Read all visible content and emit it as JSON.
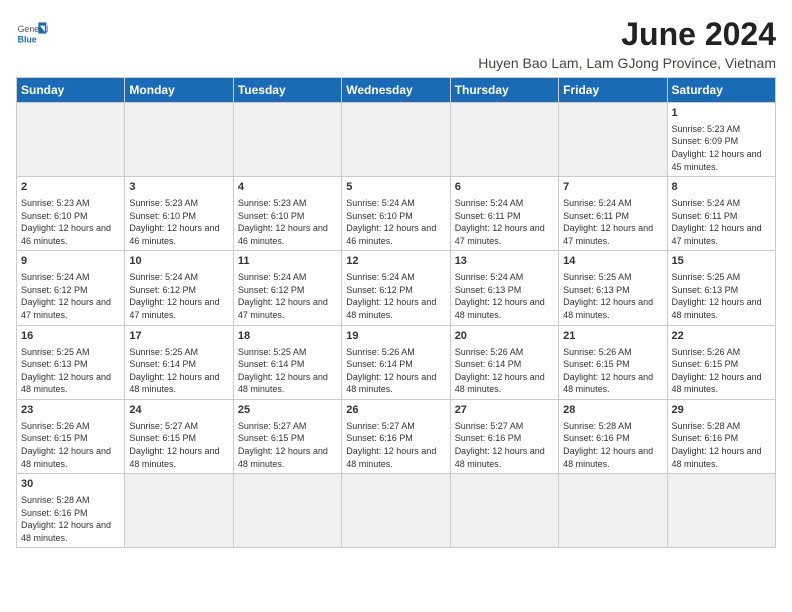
{
  "header": {
    "logo_general": "General",
    "logo_blue": "Blue",
    "month_title": "June 2024",
    "subtitle": "Huyen Bao Lam, Lam GJong Province, Vietnam"
  },
  "days_of_week": [
    "Sunday",
    "Monday",
    "Tuesday",
    "Wednesday",
    "Thursday",
    "Friday",
    "Saturday"
  ],
  "weeks": [
    [
      {
        "day": "",
        "info": "",
        "empty": true
      },
      {
        "day": "",
        "info": "",
        "empty": true
      },
      {
        "day": "",
        "info": "",
        "empty": true
      },
      {
        "day": "",
        "info": "",
        "empty": true
      },
      {
        "day": "",
        "info": "",
        "empty": true
      },
      {
        "day": "",
        "info": "",
        "empty": true
      },
      {
        "day": "1",
        "info": "Sunrise: 5:23 AM\nSunset: 6:09 PM\nDaylight: 12 hours and 45 minutes."
      }
    ],
    [
      {
        "day": "2",
        "info": "Sunrise: 5:23 AM\nSunset: 6:10 PM\nDaylight: 12 hours and 46 minutes."
      },
      {
        "day": "3",
        "info": "Sunrise: 5:23 AM\nSunset: 6:10 PM\nDaylight: 12 hours and 46 minutes."
      },
      {
        "day": "4",
        "info": "Sunrise: 5:23 AM\nSunset: 6:10 PM\nDaylight: 12 hours and 46 minutes."
      },
      {
        "day": "5",
        "info": "Sunrise: 5:24 AM\nSunset: 6:10 PM\nDaylight: 12 hours and 46 minutes."
      },
      {
        "day": "6",
        "info": "Sunrise: 5:24 AM\nSunset: 6:11 PM\nDaylight: 12 hours and 47 minutes."
      },
      {
        "day": "7",
        "info": "Sunrise: 5:24 AM\nSunset: 6:11 PM\nDaylight: 12 hours and 47 minutes."
      },
      {
        "day": "8",
        "info": "Sunrise: 5:24 AM\nSunset: 6:11 PM\nDaylight: 12 hours and 47 minutes."
      }
    ],
    [
      {
        "day": "9",
        "info": "Sunrise: 5:24 AM\nSunset: 6:12 PM\nDaylight: 12 hours and 47 minutes."
      },
      {
        "day": "10",
        "info": "Sunrise: 5:24 AM\nSunset: 6:12 PM\nDaylight: 12 hours and 47 minutes."
      },
      {
        "day": "11",
        "info": "Sunrise: 5:24 AM\nSunset: 6:12 PM\nDaylight: 12 hours and 47 minutes."
      },
      {
        "day": "12",
        "info": "Sunrise: 5:24 AM\nSunset: 6:12 PM\nDaylight: 12 hours and 48 minutes."
      },
      {
        "day": "13",
        "info": "Sunrise: 5:24 AM\nSunset: 6:13 PM\nDaylight: 12 hours and 48 minutes."
      },
      {
        "day": "14",
        "info": "Sunrise: 5:25 AM\nSunset: 6:13 PM\nDaylight: 12 hours and 48 minutes."
      },
      {
        "day": "15",
        "info": "Sunrise: 5:25 AM\nSunset: 6:13 PM\nDaylight: 12 hours and 48 minutes."
      }
    ],
    [
      {
        "day": "16",
        "info": "Sunrise: 5:25 AM\nSunset: 6:13 PM\nDaylight: 12 hours and 48 minutes."
      },
      {
        "day": "17",
        "info": "Sunrise: 5:25 AM\nSunset: 6:14 PM\nDaylight: 12 hours and 48 minutes."
      },
      {
        "day": "18",
        "info": "Sunrise: 5:25 AM\nSunset: 6:14 PM\nDaylight: 12 hours and 48 minutes."
      },
      {
        "day": "19",
        "info": "Sunrise: 5:26 AM\nSunset: 6:14 PM\nDaylight: 12 hours and 48 minutes."
      },
      {
        "day": "20",
        "info": "Sunrise: 5:26 AM\nSunset: 6:14 PM\nDaylight: 12 hours and 48 minutes."
      },
      {
        "day": "21",
        "info": "Sunrise: 5:26 AM\nSunset: 6:15 PM\nDaylight: 12 hours and 48 minutes."
      },
      {
        "day": "22",
        "info": "Sunrise: 5:26 AM\nSunset: 6:15 PM\nDaylight: 12 hours and 48 minutes."
      }
    ],
    [
      {
        "day": "23",
        "info": "Sunrise: 5:26 AM\nSunset: 6:15 PM\nDaylight: 12 hours and 48 minutes."
      },
      {
        "day": "24",
        "info": "Sunrise: 5:27 AM\nSunset: 6:15 PM\nDaylight: 12 hours and 48 minutes."
      },
      {
        "day": "25",
        "info": "Sunrise: 5:27 AM\nSunset: 6:15 PM\nDaylight: 12 hours and 48 minutes."
      },
      {
        "day": "26",
        "info": "Sunrise: 5:27 AM\nSunset: 6:16 PM\nDaylight: 12 hours and 48 minutes."
      },
      {
        "day": "27",
        "info": "Sunrise: 5:27 AM\nSunset: 6:16 PM\nDaylight: 12 hours and 48 minutes."
      },
      {
        "day": "28",
        "info": "Sunrise: 5:28 AM\nSunset: 6:16 PM\nDaylight: 12 hours and 48 minutes."
      },
      {
        "day": "29",
        "info": "Sunrise: 5:28 AM\nSunset: 6:16 PM\nDaylight: 12 hours and 48 minutes."
      }
    ],
    [
      {
        "day": "30",
        "info": "Sunrise: 5:28 AM\nSunset: 6:16 PM\nDaylight: 12 hours and 48 minutes."
      },
      {
        "day": "",
        "info": "",
        "empty": true
      },
      {
        "day": "",
        "info": "",
        "empty": true
      },
      {
        "day": "",
        "info": "",
        "empty": true
      },
      {
        "day": "",
        "info": "",
        "empty": true
      },
      {
        "day": "",
        "info": "",
        "empty": true
      },
      {
        "day": "",
        "info": "",
        "empty": true
      }
    ]
  ]
}
